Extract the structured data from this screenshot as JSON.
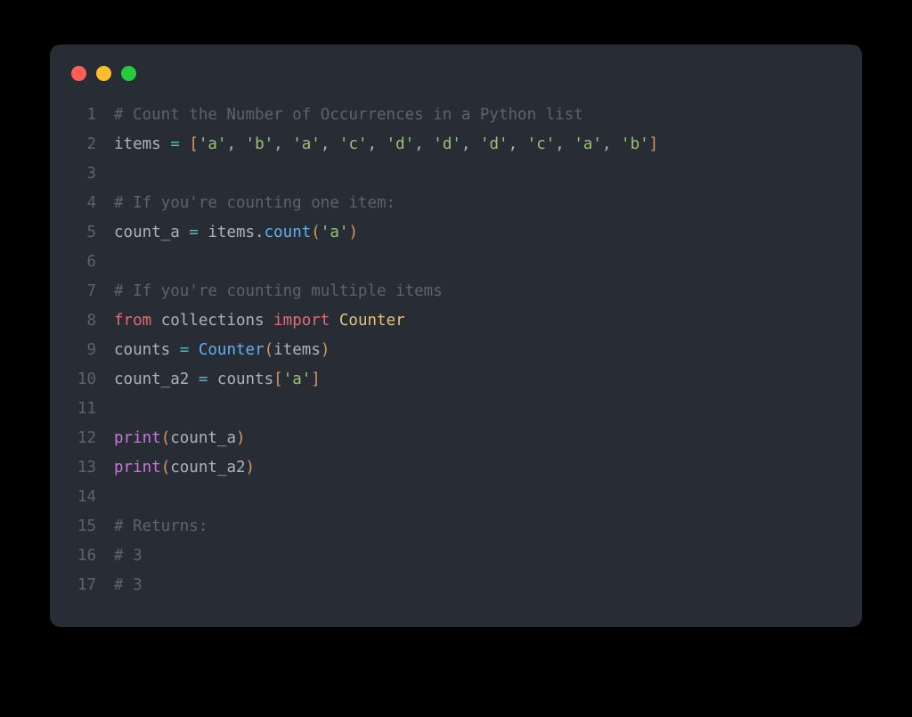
{
  "window": {
    "dots": [
      "red",
      "yellow",
      "green"
    ]
  },
  "code": {
    "lines": [
      {
        "n": 1,
        "tokens": [
          {
            "t": "# Count the Number of Occurrences in a Python list",
            "c": "c-comment"
          }
        ]
      },
      {
        "n": 2,
        "tokens": [
          {
            "t": "items ",
            "c": "c-ident"
          },
          {
            "t": "=",
            "c": "c-op"
          },
          {
            "t": " ",
            "c": ""
          },
          {
            "t": "[",
            "c": "c-bracket"
          },
          {
            "t": "'a'",
            "c": "c-string"
          },
          {
            "t": ", ",
            "c": "c-punct"
          },
          {
            "t": "'b'",
            "c": "c-string"
          },
          {
            "t": ", ",
            "c": "c-punct"
          },
          {
            "t": "'a'",
            "c": "c-string"
          },
          {
            "t": ", ",
            "c": "c-punct"
          },
          {
            "t": "'c'",
            "c": "c-string"
          },
          {
            "t": ", ",
            "c": "c-punct"
          },
          {
            "t": "'d'",
            "c": "c-string"
          },
          {
            "t": ", ",
            "c": "c-punct"
          },
          {
            "t": "'d'",
            "c": "c-string"
          },
          {
            "t": ", ",
            "c": "c-punct"
          },
          {
            "t": "'d'",
            "c": "c-string"
          },
          {
            "t": ", ",
            "c": "c-punct"
          },
          {
            "t": "'c'",
            "c": "c-string"
          },
          {
            "t": ", ",
            "c": "c-punct"
          },
          {
            "t": "'a'",
            "c": "c-string"
          },
          {
            "t": ", ",
            "c": "c-punct"
          },
          {
            "t": "'b'",
            "c": "c-string"
          },
          {
            "t": "]",
            "c": "c-bracket"
          }
        ]
      },
      {
        "n": 3,
        "tokens": []
      },
      {
        "n": 4,
        "tokens": [
          {
            "t": "# If you're counting one item:",
            "c": "c-comment"
          }
        ]
      },
      {
        "n": 5,
        "tokens": [
          {
            "t": "count_a ",
            "c": "c-ident"
          },
          {
            "t": "=",
            "c": "c-op"
          },
          {
            "t": " items.",
            "c": "c-ident"
          },
          {
            "t": "count",
            "c": "c-func"
          },
          {
            "t": "(",
            "c": "c-bracket"
          },
          {
            "t": "'a'",
            "c": "c-string"
          },
          {
            "t": ")",
            "c": "c-bracket"
          }
        ]
      },
      {
        "n": 6,
        "tokens": []
      },
      {
        "n": 7,
        "tokens": [
          {
            "t": "# If you're counting multiple items",
            "c": "c-comment"
          }
        ]
      },
      {
        "n": 8,
        "tokens": [
          {
            "t": "from",
            "c": "c-kwred"
          },
          {
            "t": " collections ",
            "c": "c-ident"
          },
          {
            "t": "import",
            "c": "c-kwred"
          },
          {
            "t": " ",
            "c": ""
          },
          {
            "t": "Counter",
            "c": "c-class"
          }
        ]
      },
      {
        "n": 9,
        "tokens": [
          {
            "t": "counts ",
            "c": "c-ident"
          },
          {
            "t": "=",
            "c": "c-op"
          },
          {
            "t": " ",
            "c": ""
          },
          {
            "t": "Counter",
            "c": "c-func"
          },
          {
            "t": "(",
            "c": "c-bracket"
          },
          {
            "t": "items",
            "c": "c-ident"
          },
          {
            "t": ")",
            "c": "c-bracket"
          }
        ]
      },
      {
        "n": 10,
        "tokens": [
          {
            "t": "count_a2 ",
            "c": "c-ident"
          },
          {
            "t": "=",
            "c": "c-op"
          },
          {
            "t": " counts",
            "c": "c-ident"
          },
          {
            "t": "[",
            "c": "c-bracket"
          },
          {
            "t": "'a'",
            "c": "c-string"
          },
          {
            "t": "]",
            "c": "c-bracket"
          }
        ]
      },
      {
        "n": 11,
        "tokens": []
      },
      {
        "n": 12,
        "tokens": [
          {
            "t": "print",
            "c": "c-keyword"
          },
          {
            "t": "(",
            "c": "c-bracket"
          },
          {
            "t": "count_a",
            "c": "c-ident"
          },
          {
            "t": ")",
            "c": "c-bracket"
          }
        ]
      },
      {
        "n": 13,
        "tokens": [
          {
            "t": "print",
            "c": "c-keyword"
          },
          {
            "t": "(",
            "c": "c-bracket"
          },
          {
            "t": "count_a2",
            "c": "c-ident"
          },
          {
            "t": ")",
            "c": "c-bracket"
          }
        ]
      },
      {
        "n": 14,
        "tokens": []
      },
      {
        "n": 15,
        "tokens": [
          {
            "t": "# Returns:",
            "c": "c-comment"
          }
        ]
      },
      {
        "n": 16,
        "tokens": [
          {
            "t": "# 3",
            "c": "c-comment"
          }
        ]
      },
      {
        "n": 17,
        "tokens": [
          {
            "t": "# 3",
            "c": "c-comment"
          }
        ]
      }
    ]
  }
}
